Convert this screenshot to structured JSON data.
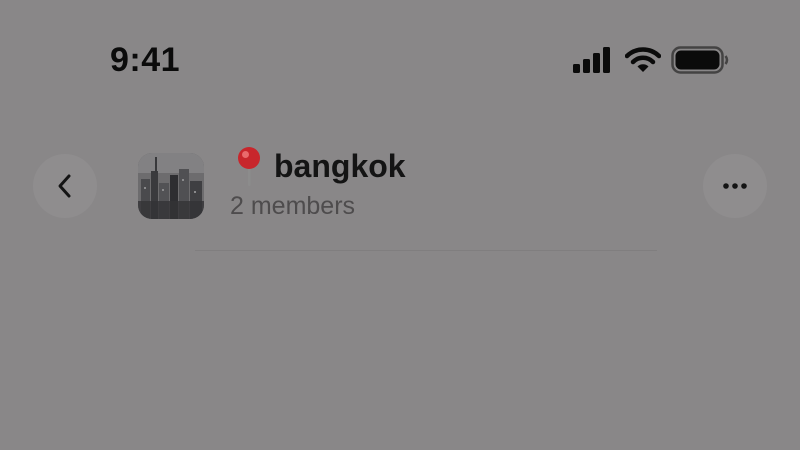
{
  "status_bar": {
    "time": "9:41",
    "icons": [
      "cellular-signal-icon",
      "wifi-icon",
      "battery-icon"
    ]
  },
  "header": {
    "back_icon": "chevron-left-icon",
    "title": "bangkok",
    "title_emoji_icon": "round-pushpin-icon",
    "subtitle": "2 members",
    "more_icon": "ellipsis-icon",
    "avatar": "group-avatar-city-photo"
  },
  "colors": {
    "background": "#898788",
    "text_primary": "#141414",
    "text_secondary": "#4e4c4d",
    "pin_red": "#c8262c"
  }
}
